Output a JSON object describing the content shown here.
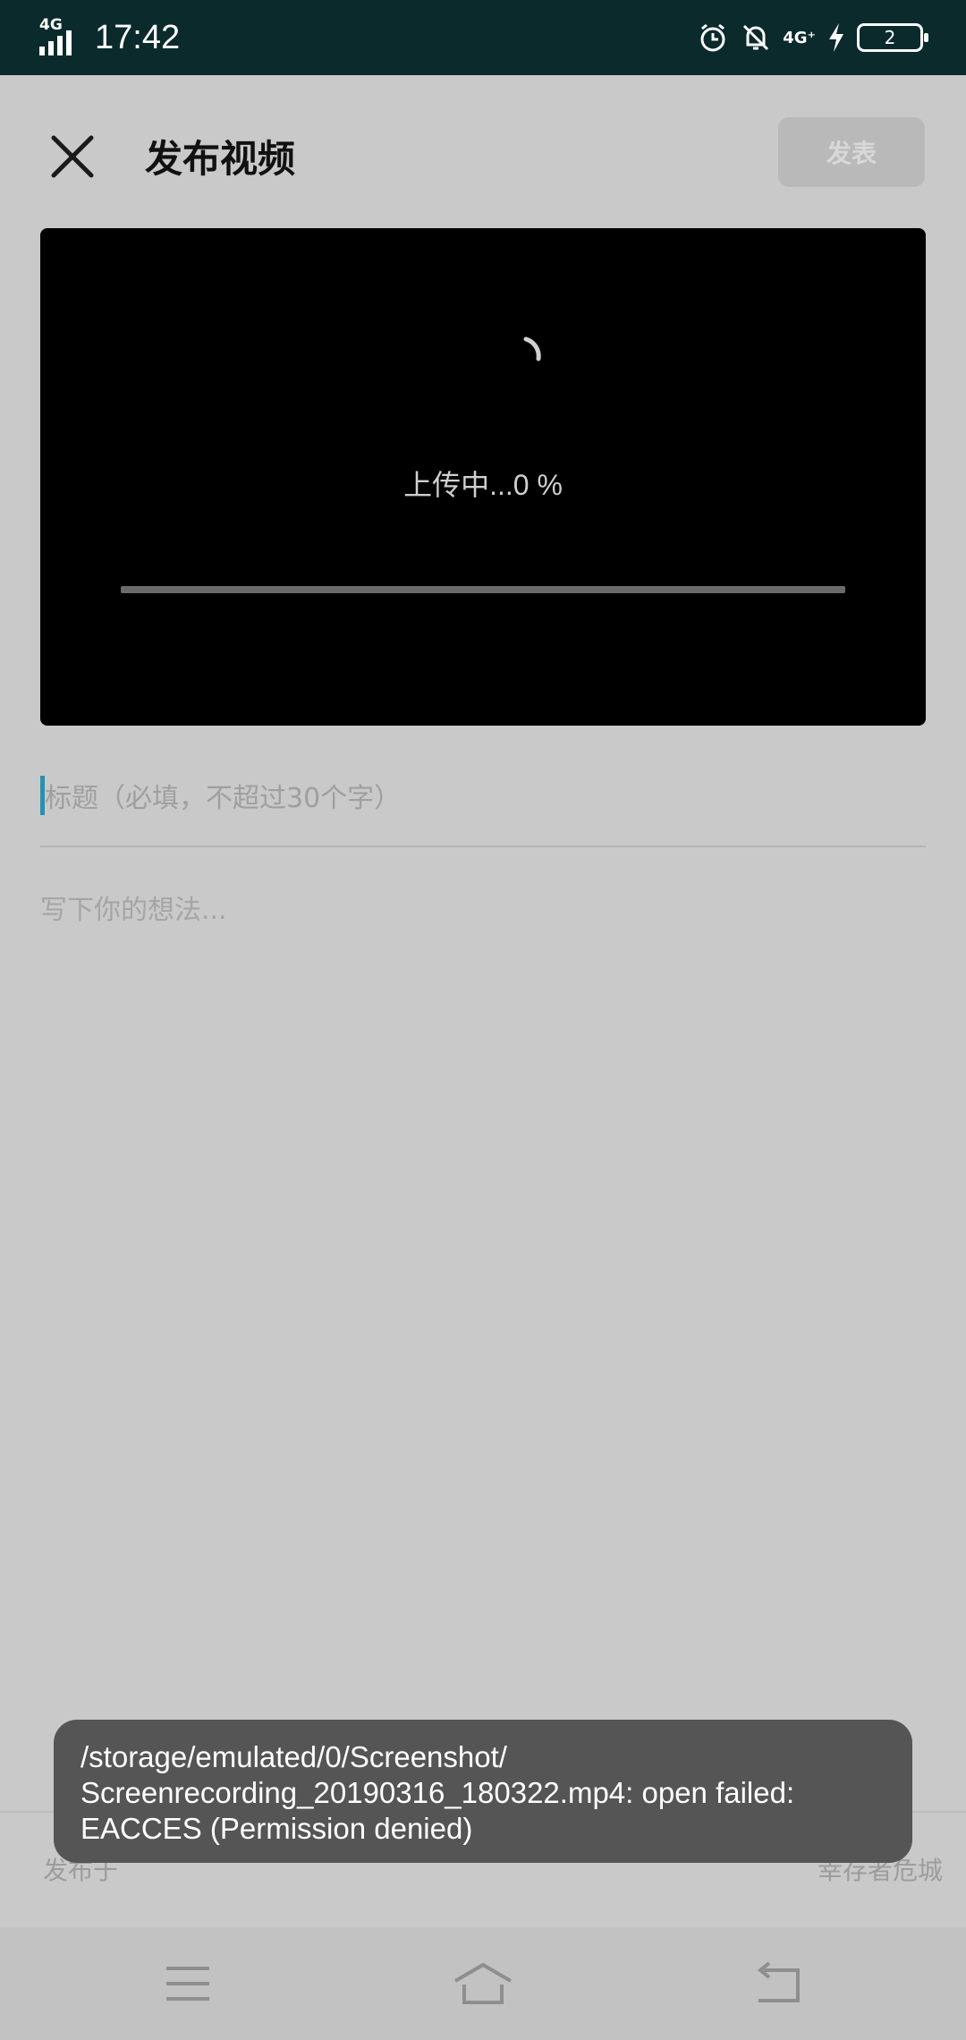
{
  "status_bar": {
    "time": "17:42",
    "network_left": "4G",
    "network_right": "4G⁺",
    "battery_level": "2",
    "icons": [
      "signal-icon",
      "alarm-icon",
      "bell-off-icon",
      "network-4g-icon",
      "charging-icon",
      "battery-icon"
    ]
  },
  "header": {
    "title": "发布视频",
    "publish_label": "发表",
    "close_icon": "close-icon"
  },
  "video": {
    "upload_text": "上传中...0 %",
    "progress_percent": 0
  },
  "form": {
    "title_placeholder": "标题（必填，不超过30个字）",
    "thoughts_placeholder": "写下你的想法..."
  },
  "publish_to": {
    "label": "发布于",
    "value": "幸存者危城"
  },
  "toast": {
    "line1": "/storage/emulated/0/Screenshot/",
    "line2": "Screenrecording_20190316_180322.mp4: open failed:",
    "line3": "EACCES (Permission denied)"
  },
  "nav": {
    "icons": [
      "menu-icon",
      "home-icon",
      "back-icon"
    ]
  },
  "colors": {
    "status_bar_bg": "#0b2a2b",
    "sheet_bg": "#c9c9c9",
    "toast_bg": "#555555",
    "caret": "#2a8fb0"
  }
}
